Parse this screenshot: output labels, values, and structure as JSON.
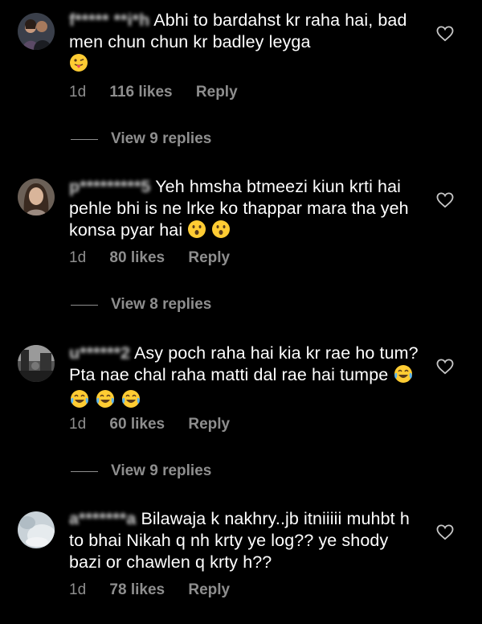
{
  "comments": [
    {
      "username": "f***** **i*h",
      "text": "Abhi to bardahst kr raha hai, bad men chun chun kr badley leyga",
      "emojis": [
        "tongue-face-emoji"
      ],
      "time": "1d",
      "likes": "116 likes",
      "reply": "Reply",
      "view_replies": "View 9 replies"
    },
    {
      "username": "p*********5",
      "text": "Yeh hmsha btmeezi kiun krti hai pehle bhi is ne lrke ko thappar mara tha yeh konsa pyar hai",
      "emojis": [
        "astonished-emoji",
        "astonished-emoji"
      ],
      "time": "1d",
      "likes": "80 likes",
      "reply": "Reply",
      "view_replies": "View 8 replies"
    },
    {
      "username": "u******2",
      "text": "Asy poch raha hai kia kr rae ho tum? Pta nae chal raha matti dal rae hai tumpe",
      "emojis": [
        "joy-emoji",
        "joy-emoji",
        "joy-emoji",
        "joy-emoji"
      ],
      "time": "1d",
      "likes": "60 likes",
      "reply": "Reply",
      "view_replies": "View 9 replies"
    },
    {
      "username": "a*******a",
      "text": "Bilawaja k nakhry..jb itniiiii muhbt h to bhai Nikah q nh krty ye log?? ye shody bazi or chawlen q krty h??",
      "emojis": [],
      "time": "1d",
      "likes": "78 likes",
      "reply": "Reply"
    }
  ],
  "colors": {
    "background": "#000000",
    "text": "#ffffff",
    "meta": "#8e8e8e"
  }
}
